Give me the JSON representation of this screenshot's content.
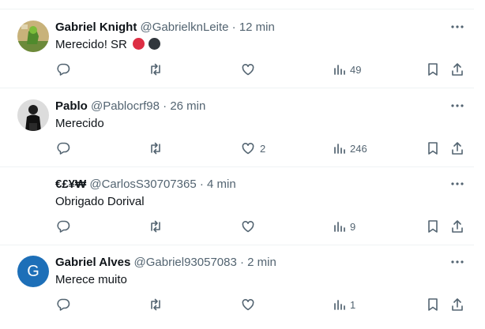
{
  "colors": {
    "text": "#0f1419",
    "secondary": "#536471",
    "border": "#eff3f4",
    "avatar_g": "#1d6fb8",
    "emoji_red": "#dd2e44",
    "emoji_black": "#31373d"
  },
  "tweets": [
    {
      "name": "Gabriel Knight",
      "handle": "@GabrielknLeite",
      "time": "12 min",
      "text": "Merecido! SR",
      "emoji": [
        "red-circle",
        "black-circle"
      ],
      "likes": "",
      "views": "49"
    },
    {
      "name": "Pablo",
      "handle": "@Pablocrf98",
      "time": "26 min",
      "text": "Merecido",
      "likes": "2",
      "views": "246"
    },
    {
      "name": "€£¥₩",
      "handle": "@CarlosS30707365",
      "time": "4 min",
      "text": "Obrigado Dorival",
      "likes": "",
      "views": "9"
    },
    {
      "name": "Gabriel Alves",
      "handle": "@Gabriel93057083",
      "time": "2 min",
      "text": "Merece muito",
      "avatar_letter": "G",
      "likes": "",
      "views": "1"
    }
  ],
  "separator": "·"
}
